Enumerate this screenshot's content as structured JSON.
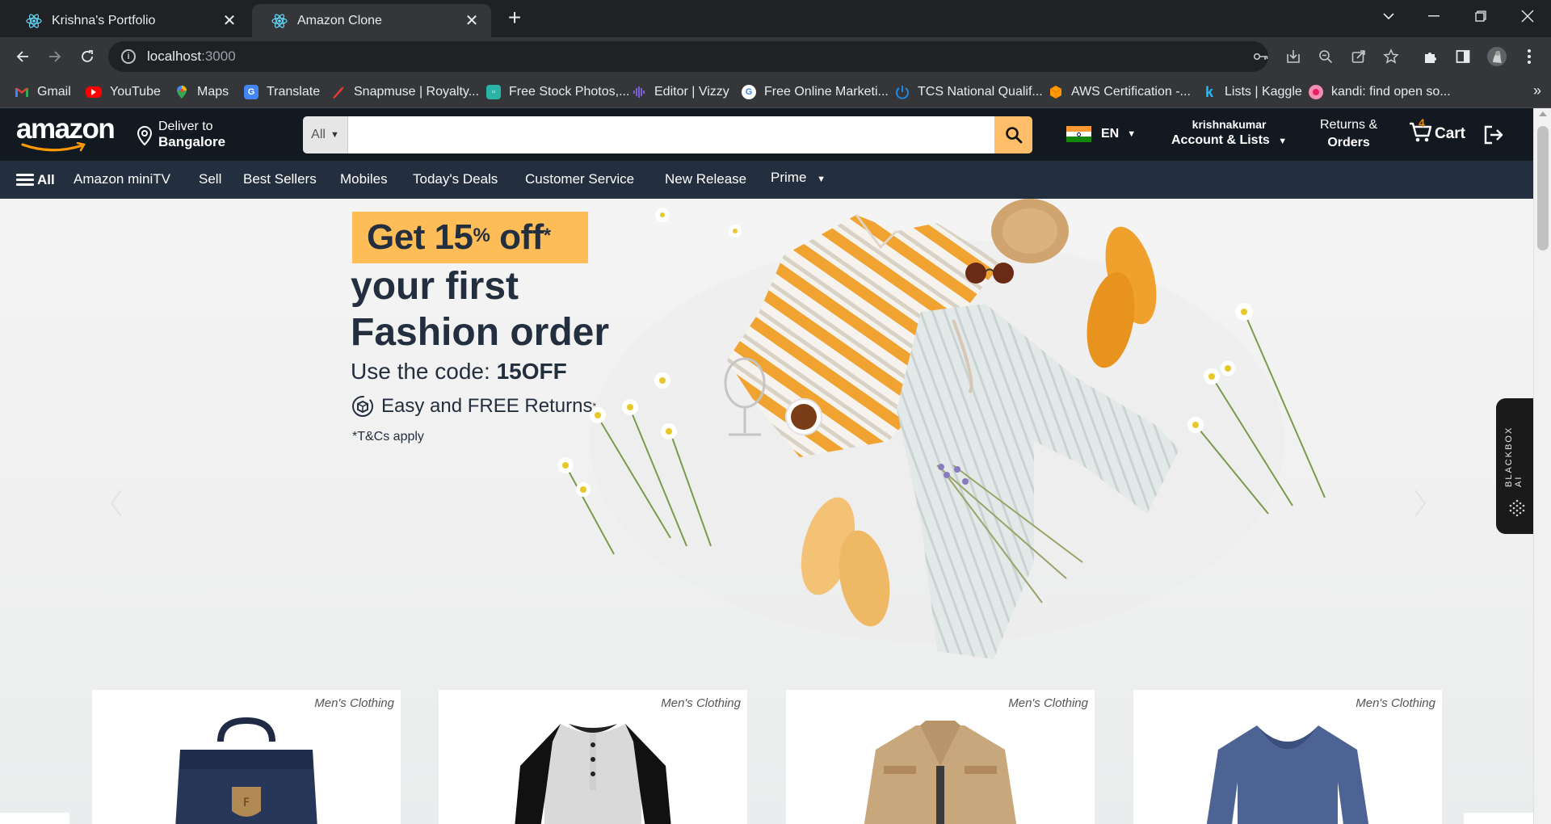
{
  "browser": {
    "tabs": [
      {
        "title": "Krishna's Portfolio",
        "active": false
      },
      {
        "title": "Amazon Clone",
        "active": true
      }
    ],
    "address": {
      "host": "localhost",
      "port": ":3000"
    },
    "bookmarks": [
      {
        "label": "Gmail",
        "icon": "gmail-icon",
        "color": "#ea4335"
      },
      {
        "label": "YouTube",
        "icon": "youtube-icon",
        "color": "#ff0000"
      },
      {
        "label": "Maps",
        "icon": "maps-icon",
        "color": "#34a853"
      },
      {
        "label": "Translate",
        "icon": "translate-icon",
        "color": "#4285f4"
      },
      {
        "label": "Snapmuse | Royalty...",
        "icon": "snapmuse-icon",
        "color": "#e53935"
      },
      {
        "label": "Free Stock Photos,...",
        "icon": "stock-photos-icon",
        "color": "#2ab3a6"
      },
      {
        "label": "Editor | Vizzy",
        "icon": "vizzy-icon",
        "color": "#7b5cff"
      },
      {
        "label": "Free Online Marketi...",
        "icon": "google-icon",
        "color": "#4285f4"
      },
      {
        "label": "TCS National Qualif...",
        "icon": "tcs-icon",
        "color": "#1e88e5"
      },
      {
        "label": "AWS Certification -...",
        "icon": "aws-icon",
        "color": "#ff9900"
      },
      {
        "label": "Lists | Kaggle",
        "icon": "kaggle-icon",
        "color": "#20beff"
      },
      {
        "label": "kandi: find open so...",
        "icon": "kandi-icon",
        "color": "#e91e63"
      }
    ]
  },
  "header": {
    "logo_text": "amazon",
    "deliver_line1": "Deliver to",
    "deliver_line2": "Bangalore",
    "search_category": "All",
    "search_placeholder": "",
    "language": "EN",
    "account_name": "krishnakumar",
    "account_label": "Account & Lists",
    "returns_line1": "Returns &",
    "returns_line2": "Orders",
    "cart_count": "4",
    "cart_label": "Cart"
  },
  "subnav": {
    "all_label": "All",
    "items": [
      "Amazon miniTV",
      "Sell",
      "Best Sellers",
      "Mobiles",
      "Today's Deals",
      "Customer Service",
      "New Release",
      "Prime"
    ]
  },
  "hero": {
    "badge_main": "Get 15",
    "badge_percent": "%",
    "badge_off": " off",
    "badge_star": "*",
    "line1": "your first",
    "line2": "Fashion order",
    "code_prefix": "Use the code: ",
    "code": "15OFF",
    "returns": "Easy and FREE Returns",
    "returns_star": "*",
    "terms": "*T&Cs apply"
  },
  "products": [
    {
      "category": "Men's Clothing",
      "image": "backpack"
    },
    {
      "category": "Men's Clothing",
      "image": "raglan-shirt"
    },
    {
      "category": "Men's Clothing",
      "image": "jacket"
    },
    {
      "category": "Men's Clothing",
      "image": "v-neck-tee"
    }
  ],
  "ai_widget": {
    "label": "BLACKBOX AI"
  },
  "colors": {
    "header_bg": "#131921",
    "subnav_bg": "#232f3e",
    "search_button": "#febd69",
    "promo_badge": "#febd57",
    "cart_count": "#f08804"
  }
}
